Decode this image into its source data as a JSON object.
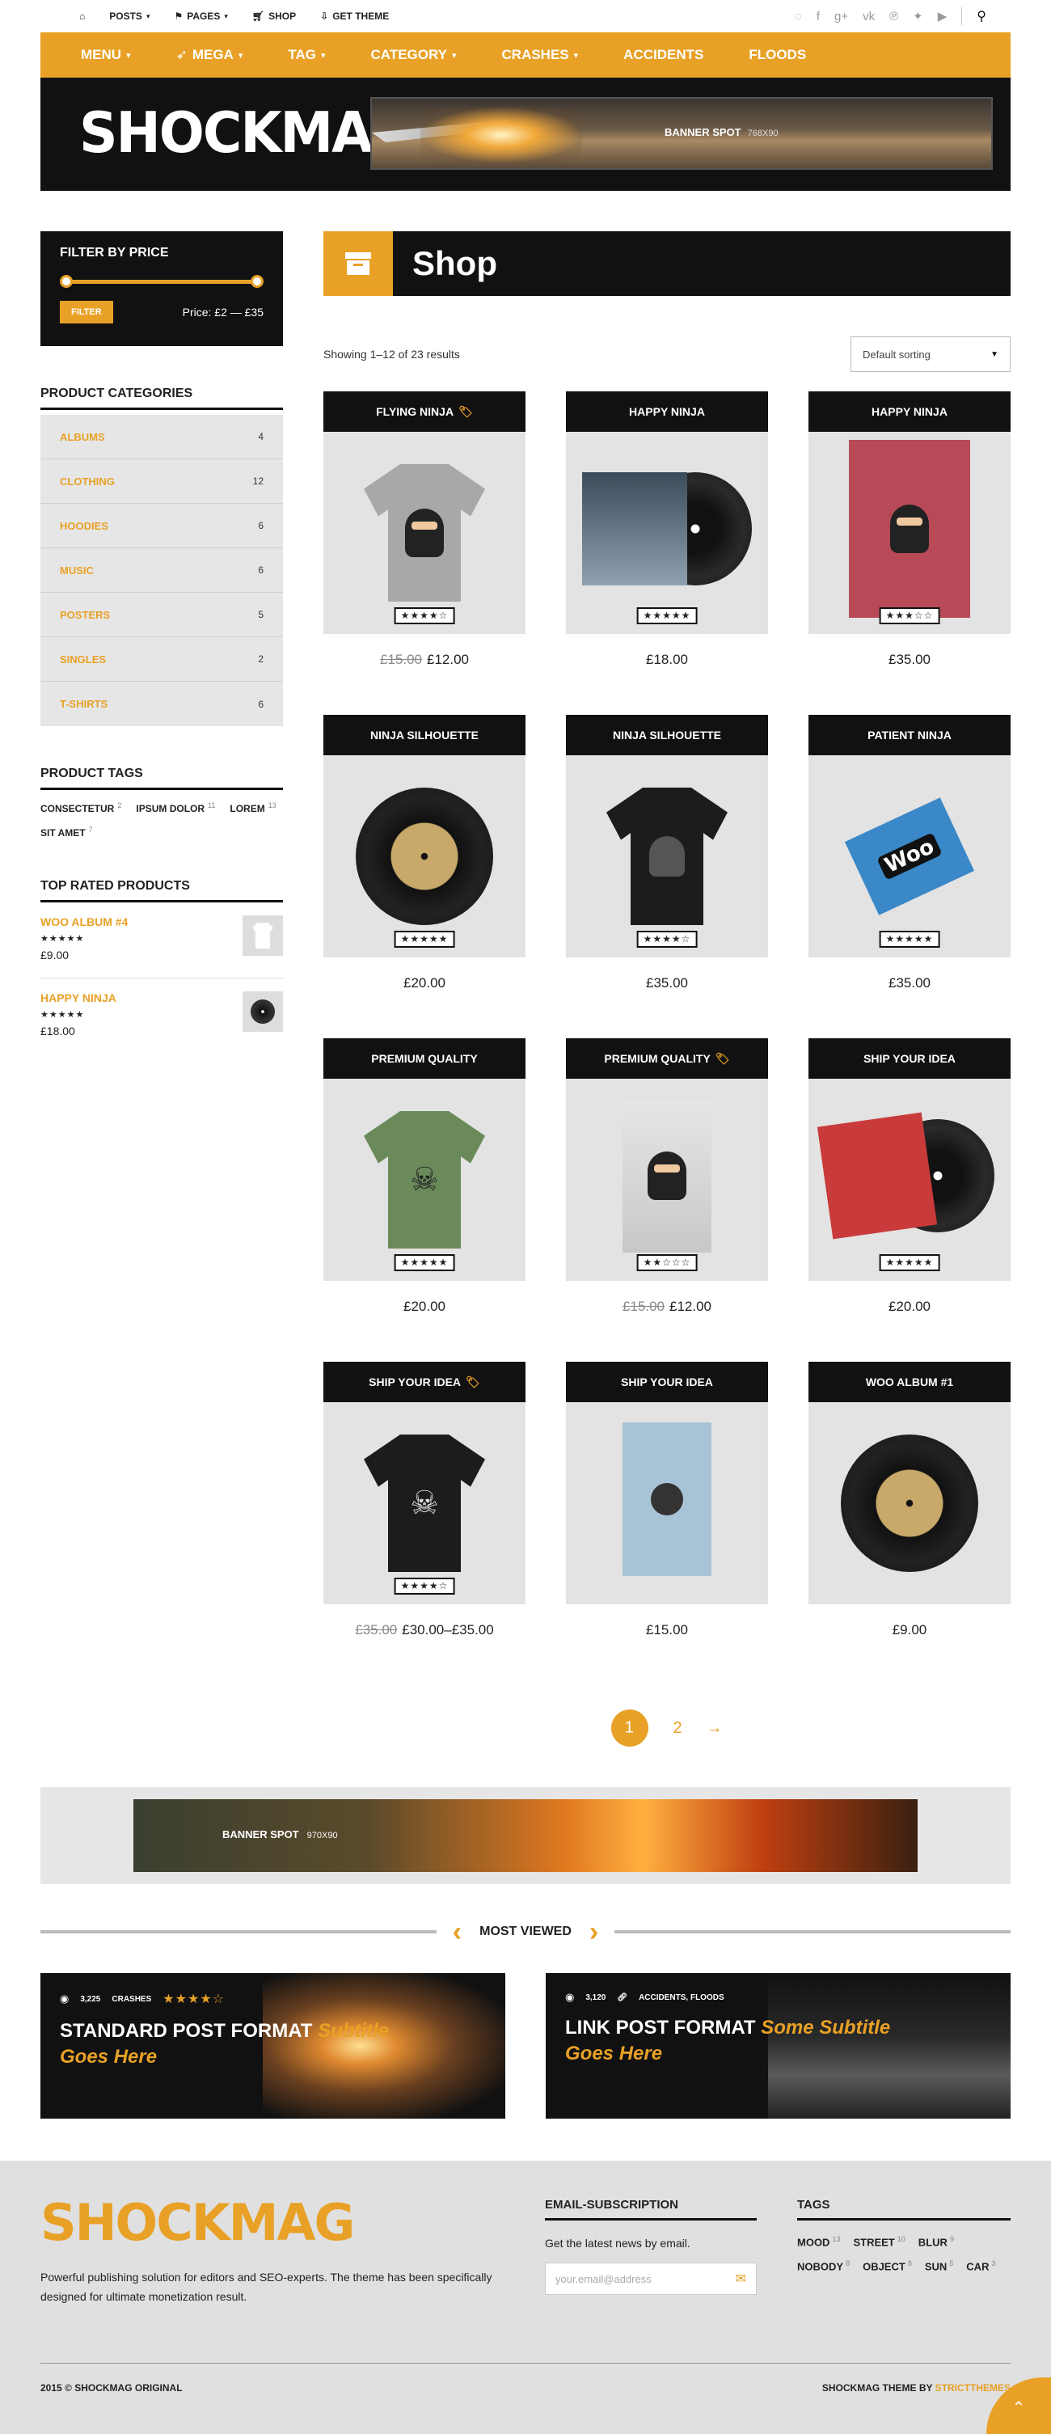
{
  "topnav": {
    "home_icon": "home-icon",
    "posts": "Posts",
    "pages": "Pages",
    "shop": "Shop",
    "get_theme": "Get Theme"
  },
  "social": [
    "rss-icon",
    "facebook-icon",
    "google-plus-icon",
    "vk-icon",
    "pinterest-icon",
    "twitter-icon",
    "youtube-icon"
  ],
  "menu": [
    "Menu",
    "Mega",
    "Tag",
    "Category",
    "Crashes",
    "Accidents",
    "Floods"
  ],
  "header": {
    "logo": "SHOCKMAG",
    "banner_label": "BANNER SPOT",
    "banner_size": "768X90"
  },
  "filter": {
    "title": "Filter by price",
    "button": "Filter",
    "price": "Price: £2 — £35"
  },
  "categories": {
    "title": "Product Categories",
    "items": [
      {
        "name": "Albums",
        "count": "4"
      },
      {
        "name": "Clothing",
        "count": "12"
      },
      {
        "name": "Hoodies",
        "count": "6"
      },
      {
        "name": "Music",
        "count": "6"
      },
      {
        "name": "Posters",
        "count": "5"
      },
      {
        "name": "Singles",
        "count": "2"
      },
      {
        "name": "T-Shirts",
        "count": "6"
      }
    ]
  },
  "tags": {
    "title": "Product Tags",
    "items": [
      {
        "name": "Consectetur",
        "count": "2"
      },
      {
        "name": "Ipsum Dolor",
        "count": "11"
      },
      {
        "name": "Lorem",
        "count": "13"
      },
      {
        "name": "Sit Amet",
        "count": "7"
      }
    ]
  },
  "top_rated": {
    "title": "Top Rated Products",
    "items": [
      {
        "name": "Woo Album #4",
        "stars": "★★★★★",
        "price": "£9.00"
      },
      {
        "name": "Happy Ninja",
        "stars": "★★★★★",
        "price": "£18.00"
      }
    ]
  },
  "shop": {
    "title": "Shop",
    "result_count": "Showing 1–12 of 23 results",
    "sorting": "Default sorting"
  },
  "products": [
    {
      "name": "Flying Ninja",
      "sale": true,
      "old_price": "£15.00",
      "price": "£12.00",
      "rating": "★★★★☆"
    },
    {
      "name": "Happy Ninja",
      "sale": false,
      "old_price": "",
      "price": "£18.00",
      "rating": "★★★★★"
    },
    {
      "name": "Happy Ninja",
      "sale": false,
      "old_price": "",
      "price": "£35.00",
      "rating": "★★★☆☆"
    },
    {
      "name": "Ninja Silhouette",
      "sale": false,
      "old_price": "",
      "price": "£20.00",
      "rating": "★★★★★"
    },
    {
      "name": "Ninja Silhouette",
      "sale": false,
      "old_price": "",
      "price": "£35.00",
      "rating": "★★★★☆"
    },
    {
      "name": "Patient Ninja",
      "sale": false,
      "old_price": "",
      "price": "£35.00",
      "rating": "★★★★★"
    },
    {
      "name": "Premium Quality",
      "sale": false,
      "old_price": "",
      "price": "£20.00",
      "rating": "★★★★★"
    },
    {
      "name": "Premium Quality",
      "sale": true,
      "old_price": "£15.00",
      "price": "£12.00",
      "rating": "★★☆☆☆"
    },
    {
      "name": "Ship Your Idea",
      "sale": false,
      "old_price": "",
      "price": "£20.00",
      "rating": "★★★★★"
    },
    {
      "name": "Ship Your Idea",
      "sale": true,
      "old_price": "£35.00",
      "price": "£30.00–£35.00",
      "rating": "★★★★☆"
    },
    {
      "name": "Ship Your Idea",
      "sale": false,
      "old_price": "",
      "price": "£15.00",
      "rating": ""
    },
    {
      "name": "Woo Album #1",
      "sale": false,
      "old_price": "",
      "price": "£9.00",
      "rating": ""
    }
  ],
  "pagination": {
    "current": "1",
    "next_page": "2",
    "next": "→"
  },
  "banner2": {
    "label": "BANNER SPOT",
    "size": "970X90"
  },
  "most_viewed": {
    "title": "Most Viewed",
    "posts": [
      {
        "views": "3,225",
        "cats": "Crashes",
        "stars": "★★★★☆",
        "title": "Standard Post Format",
        "subtitle": "Subtitle Goes Here"
      },
      {
        "views": "3,120",
        "cats": "Accidents, Floods",
        "stars": "",
        "title": "Link Post Format",
        "subtitle": "Some Subtitle Goes Here"
      }
    ]
  },
  "footer": {
    "logo": "SHOCKMAG",
    "description": "Powerful publishing solution for editors and SEO-experts. The theme has been specifically designed for ultimate monetization result.",
    "email_title": "Email-Subscription",
    "email_text": "Get the latest news by email.",
    "email_placeholder": "your.email@address",
    "tags_title": "Tags",
    "tags": [
      {
        "name": "Mood",
        "count": "13"
      },
      {
        "name": "Street",
        "count": "10"
      },
      {
        "name": "Blur",
        "count": "9"
      },
      {
        "name": "Nobody",
        "count": "8"
      },
      {
        "name": "Object",
        "count": "8"
      },
      {
        "name": "Sun",
        "count": "5"
      },
      {
        "name": "Car",
        "count": "3"
      }
    ],
    "copyright": "2015 © SHOCKMAG ORIGINAL",
    "credit": "SHOCKMAG THEME BY",
    "credit_link": "STRICTTHEMES"
  },
  "colors": {
    "accent": "#e8a126",
    "dark": "#111111",
    "light_gray": "#e6e6e6"
  }
}
